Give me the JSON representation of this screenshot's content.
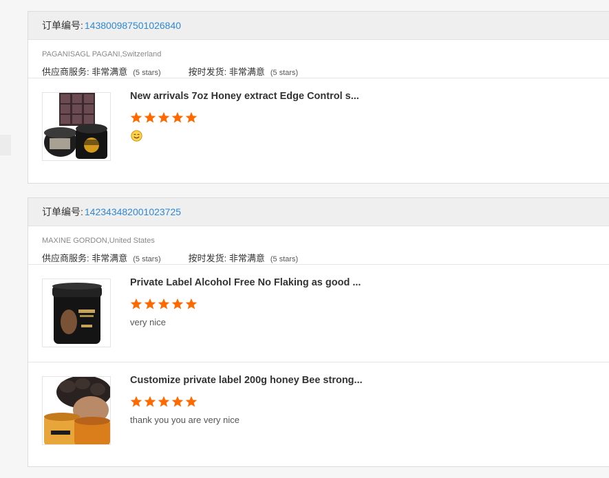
{
  "orders": [
    {
      "order_label": "订单编号:",
      "order_number": "143800987501026840",
      "supplier": "PAGANISAGL PAGANI,Switzerland",
      "service_label": "供应商服务:",
      "service_value": "非常满意",
      "service_stars": "(5 stars)",
      "ontime_label": "按时发货:",
      "ontime_value": "非常满意",
      "ontime_stars": "(5 stars)",
      "products": [
        {
          "title": "New arrivals 7oz Honey extract Edge Control s...",
          "rating": 5,
          "review_icon": "smiley-face-icon"
        }
      ]
    },
    {
      "order_label": "订单编号:",
      "order_number": "142343482001023725",
      "supplier": "MAXINE GORDON,United States",
      "service_label": "供应商服务:",
      "service_value": "非常满意",
      "service_stars": "(5 stars)",
      "ontime_label": "按时发货:",
      "ontime_value": "非常满意",
      "ontime_stars": "(5 stars)",
      "products": [
        {
          "title": "Private Label Alcohol Free No Flaking as good ...",
          "rating": 5,
          "review": "very nice"
        },
        {
          "title": "Customize private label 200g honey Bee strong...",
          "rating": 5,
          "review": "thank you you are very nice"
        }
      ]
    }
  ],
  "colors": {
    "star": "#ff6a00",
    "link": "#2e88d4",
    "header_bg": "#efefef"
  }
}
